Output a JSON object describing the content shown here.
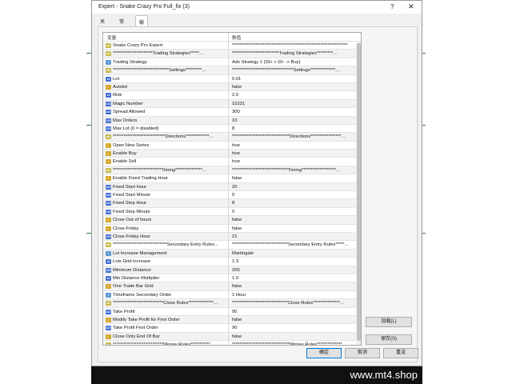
{
  "window": {
    "title": "Expert - Snake Crazy Pro Full_fix (3)",
    "help_glyph": "?",
    "close_glyph": "✕"
  },
  "tabs": [
    {
      "label": "关于"
    },
    {
      "label": "常用"
    },
    {
      "label": "输入参数"
    }
  ],
  "grid": {
    "col_variable": "变量",
    "col_value": "数值",
    "rows": [
      {
        "icon": "ab",
        "name": "Snake Crazy Pro Expert",
        "value": "****************************************************************"
      },
      {
        "icon": "ab",
        "name": "**********************Trading Strategies*****...",
        "value": "**************************Trading Strategies*********..."
      },
      {
        "icon": "lst",
        "name": "Trading Strategy",
        "value": "Adx Strategy 1 (DI+ > DI- -> Buy)"
      },
      {
        "icon": "ab",
        "name": "*******************************Settings*********...",
        "value": "**********************************Settings**************..."
      },
      {
        "icon": "dbl",
        "name": "Lot",
        "value": "0.01"
      },
      {
        "icon": "bool",
        "name": "Autolot",
        "value": "false"
      },
      {
        "icon": "dbl",
        "name": "Risk",
        "value": "2.0"
      },
      {
        "icon": "num",
        "name": "Magic Number",
        "value": "15231"
      },
      {
        "icon": "num",
        "name": "Spread Allowed",
        "value": "300"
      },
      {
        "icon": "num",
        "name": "Max Orders",
        "value": "10"
      },
      {
        "icon": "num",
        "name": "Max Lot (0 = disabled)",
        "value": "8"
      },
      {
        "icon": "ab",
        "name": "*****************************Directions*************...",
        "value": "********************************Directions*****************..."
      },
      {
        "icon": "bool",
        "name": "Open New Series",
        "value": "true"
      },
      {
        "icon": "bool",
        "name": "Enable Buy",
        "value": "true"
      },
      {
        "icon": "bool",
        "name": "Enable Sell",
        "value": "true"
      },
      {
        "icon": "ab",
        "name": "***************************Timing***************...",
        "value": "*******************************Timing*******************..."
      },
      {
        "icon": "bool",
        "name": "Enable Fixed Trading Hour",
        "value": "false"
      },
      {
        "icon": "num",
        "name": "Fixed Start Hour",
        "value": "20"
      },
      {
        "icon": "num",
        "name": "Fixed Start Minute",
        "value": "0"
      },
      {
        "icon": "num",
        "name": "Fixed Stop Hour",
        "value": "8"
      },
      {
        "icon": "num",
        "name": "Fixed Stop Minute",
        "value": "0"
      },
      {
        "icon": "bool",
        "name": "Close Out of hours",
        "value": "false"
      },
      {
        "icon": "bool",
        "name": "Close Friday",
        "value": "false"
      },
      {
        "icon": "num",
        "name": "Close Friday Hour",
        "value": "21"
      },
      {
        "icon": "ab",
        "name": "******************************Secondary Entry Rules...",
        "value": "*******************************Secondary Entry Rules*****..."
      },
      {
        "icon": "lst",
        "name": "Lot Increase Management",
        "value": "Martingale"
      },
      {
        "icon": "dbl",
        "name": "Lots Grid increase",
        "value": "1.3"
      },
      {
        "icon": "num",
        "name": "Minimum Distance",
        "value": "200"
      },
      {
        "icon": "dbl",
        "name": "Min Distance Multiplier",
        "value": "1.0"
      },
      {
        "icon": "bool",
        "name": "One Trade Bar Grid",
        "value": "false"
      },
      {
        "icon": "lst",
        "name": "Timeframe Secondary Order",
        "value": "1 Hour"
      },
      {
        "icon": "ab",
        "name": "****************************Close Rules**************...",
        "value": "*******************************Close Rules***************..."
      },
      {
        "icon": "num",
        "name": "Take Profit",
        "value": "90"
      },
      {
        "icon": "bool",
        "name": "Modify Take Profit for First Order",
        "value": "false"
      },
      {
        "icon": "num",
        "name": "Take Profit First Order",
        "value": "90"
      },
      {
        "icon": "bool",
        "name": "Close Only End Of Bar",
        "value": "false"
      },
      {
        "icon": "ab",
        "name": "****************************Money Rules***********...",
        "value": "********************************Money Rules**************..."
      }
    ]
  },
  "buttons": {
    "load": "加载(L)",
    "save": "保存(S)",
    "ok": "确定",
    "cancel": "取消",
    "reset": "重设"
  },
  "watermark": "www.mt4.shop"
}
